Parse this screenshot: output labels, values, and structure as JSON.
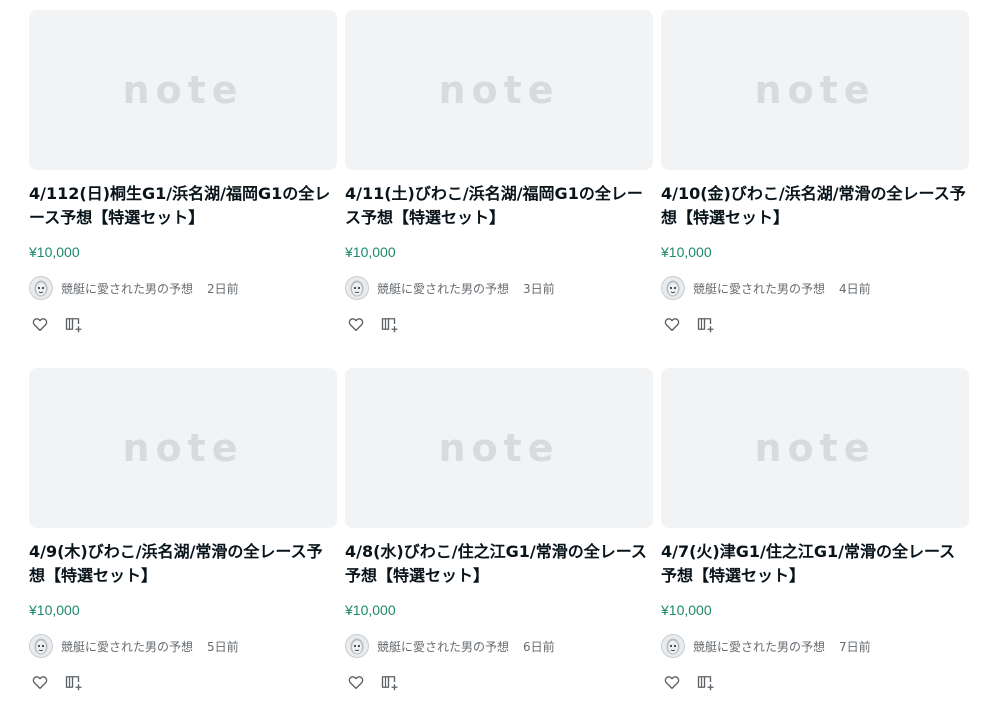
{
  "colors": {
    "price": "#1d8a6b",
    "thumbnail_bg": "#f1f3f5",
    "thumbnail_logo": "#d8dbde",
    "meta_text": "#676c70",
    "title_text": "#08131a"
  },
  "thumbnail_logo_text": "note",
  "cards": [
    {
      "title": "4/112(日)桐生G1/浜名湖/福岡G1の全レース予想【特選セット】",
      "price": "¥10,000",
      "author": "競艇に愛された男の予想",
      "time": "2日前",
      "like_icon": "heart-icon",
      "magazine_icon": "add-to-magazine-icon"
    },
    {
      "title": "4/11(土)びわこ/浜名湖/福岡G1の全レース予想【特選セット】",
      "price": "¥10,000",
      "author": "競艇に愛された男の予想",
      "time": "3日前",
      "like_icon": "heart-icon",
      "magazine_icon": "add-to-magazine-icon"
    },
    {
      "title": "4/10(金)びわこ/浜名湖/常滑の全レース予想【特選セット】",
      "price": "¥10,000",
      "author": "競艇に愛された男の予想",
      "time": "4日前",
      "like_icon": "heart-icon",
      "magazine_icon": "add-to-magazine-icon"
    },
    {
      "title": "4/9(木)びわこ/浜名湖/常滑の全レース予想【特選セット】",
      "price": "¥10,000",
      "author": "競艇に愛された男の予想",
      "time": "5日前",
      "like_icon": "heart-icon",
      "magazine_icon": "add-to-magazine-icon"
    },
    {
      "title": "4/8(水)びわこ/住之江G1/常滑の全レース予想【特選セット】",
      "price": "¥10,000",
      "author": "競艇に愛された男の予想",
      "time": "6日前",
      "like_icon": "heart-icon",
      "magazine_icon": "add-to-magazine-icon"
    },
    {
      "title": "4/7(火)津G1/住之江G1/常滑の全レース予想【特選セット】",
      "price": "¥10,000",
      "author": "競艇に愛された男の予想",
      "time": "7日前",
      "like_icon": "heart-icon",
      "magazine_icon": "add-to-magazine-icon"
    }
  ]
}
